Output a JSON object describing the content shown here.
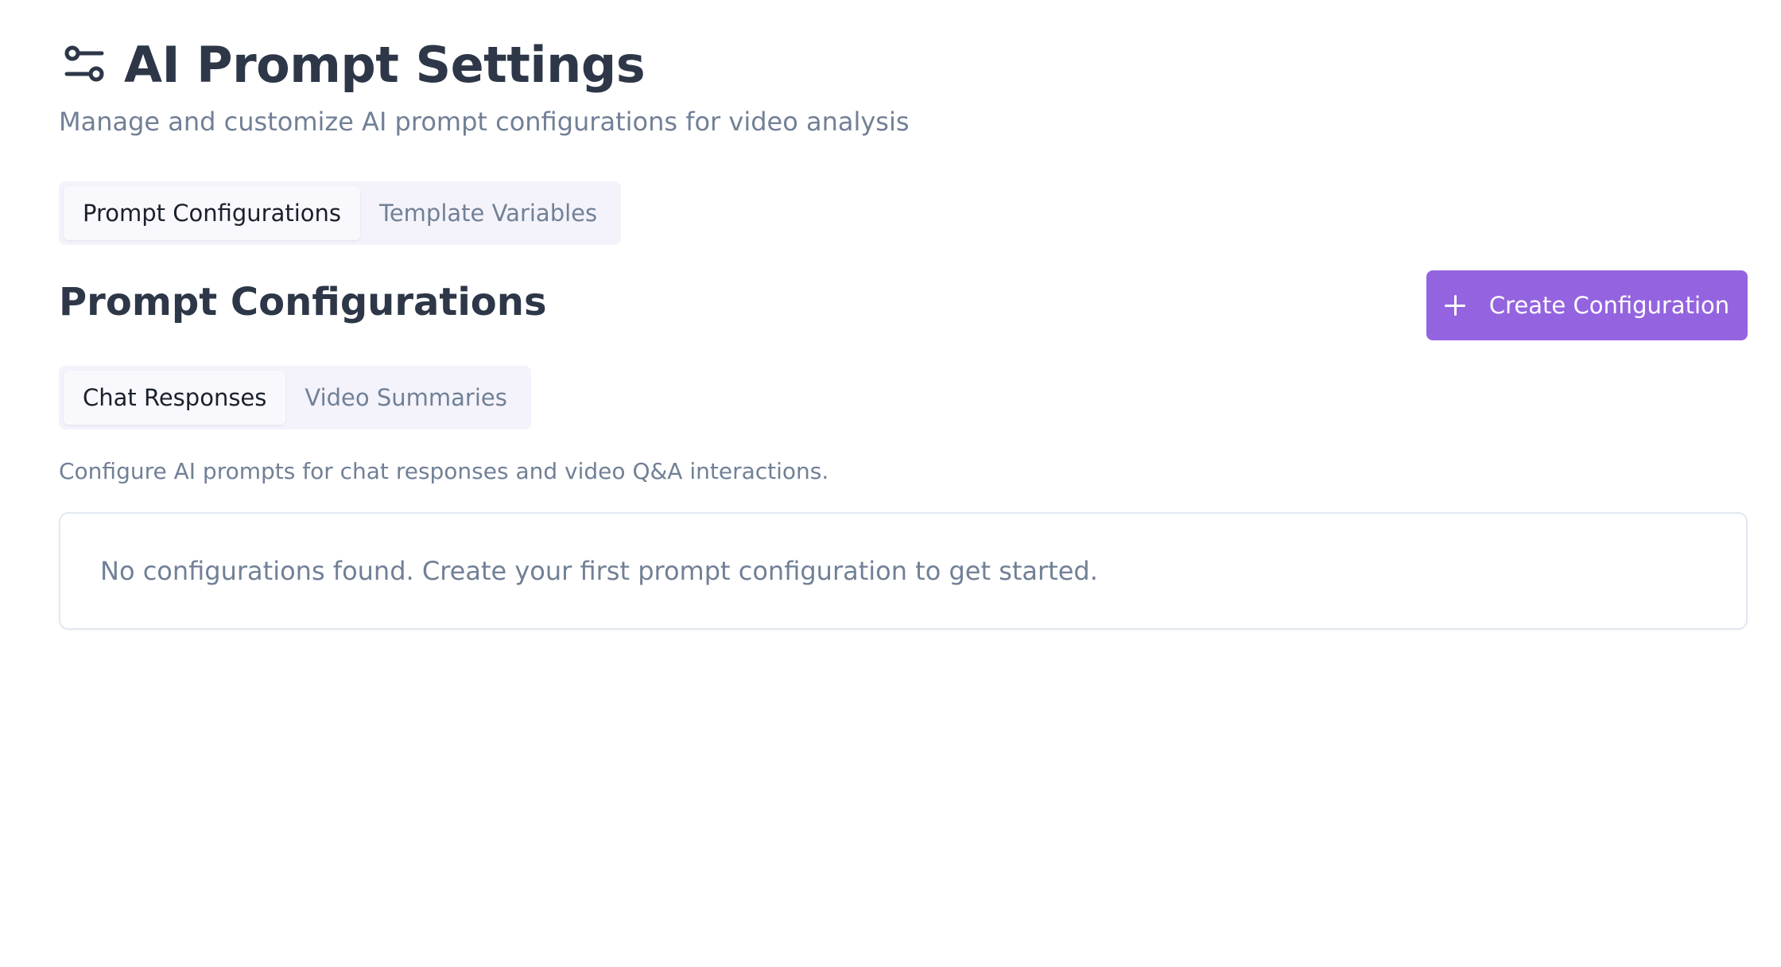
{
  "header": {
    "title": "AI Prompt Settings",
    "icon": "sliders-icon",
    "subtitle": "Manage and customize AI prompt configurations for video analysis"
  },
  "main_tabs": [
    {
      "label": "Prompt Configurations",
      "active": true
    },
    {
      "label": "Template Variables",
      "active": false
    }
  ],
  "section": {
    "title": "Prompt Configurations",
    "create_button_label": "Create Configuration",
    "create_button_icon": "plus-icon",
    "accent_color": "#9464e0"
  },
  "sub_tabs": [
    {
      "label": "Chat Responses",
      "active": true
    },
    {
      "label": "Video Summaries",
      "active": false
    }
  ],
  "description": "Configure AI prompts for chat responses and video Q&A interactions.",
  "empty_state": {
    "message": "No configurations found. Create your first prompt configuration to get started."
  }
}
